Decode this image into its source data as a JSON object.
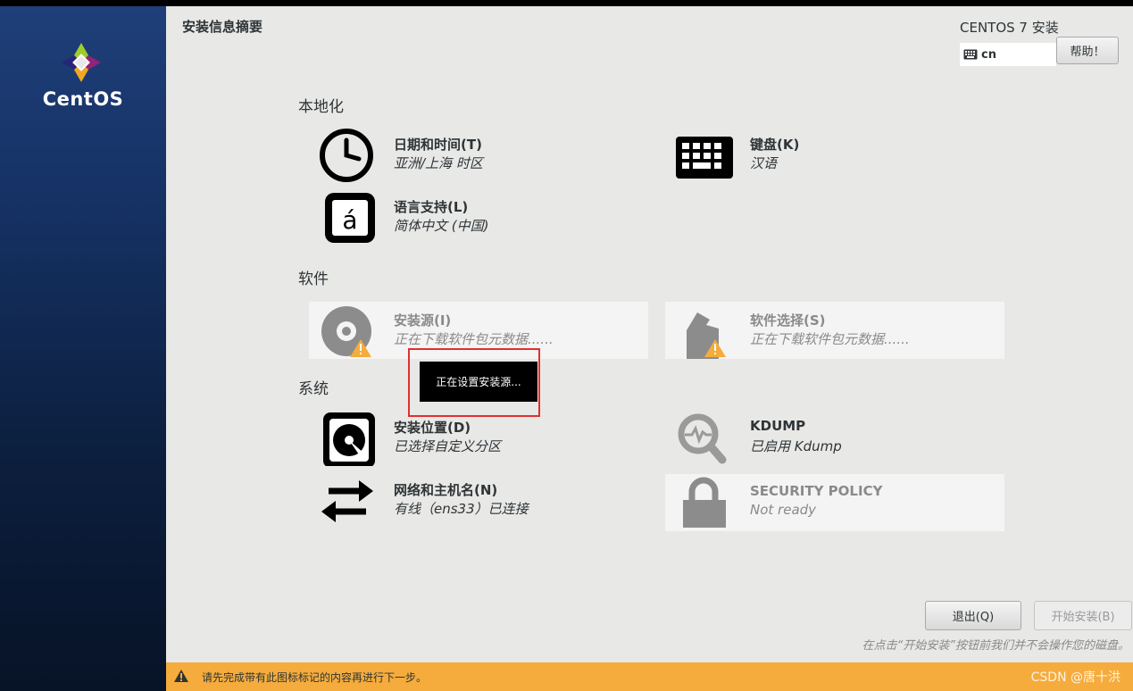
{
  "sidebar": {
    "logo_text": "CentOS"
  },
  "header": {
    "title": "安装信息摘要",
    "product": "CENTOS 7 安装",
    "keyboard_layout": "cn",
    "help_label": "帮助！"
  },
  "sections": {
    "localization": "本地化",
    "software": "软件",
    "system": "系统"
  },
  "spokes": {
    "datetime": {
      "title": "日期和时间(T)",
      "status": "亚洲/上海 时区",
      "icon": "clock-icon"
    },
    "keyboard": {
      "title": "键盘(K)",
      "status": "汉语",
      "icon": "keyboard-icon"
    },
    "language": {
      "title": "语言支持(L)",
      "status": "简体中文 (中国)",
      "icon": "language-icon"
    },
    "source": {
      "title": "安装源(I)",
      "status": "正在下载软件包元数据......",
      "icon": "disc-icon"
    },
    "software": {
      "title": "软件选择(S)",
      "status": "正在下载软件包元数据......",
      "icon": "package-icon"
    },
    "destination": {
      "title": "安装位置(D)",
      "status": "已选择自定义分区",
      "icon": "harddisk-icon"
    },
    "kdump": {
      "title": "KDUMP",
      "status": "已启用 Kdump",
      "icon": "magnifier-icon"
    },
    "network": {
      "title": "网络和主机名(N)",
      "status": "有线（ens33）已连接",
      "icon": "network-arrows-icon"
    },
    "security": {
      "title": "SECURITY POLICY",
      "status": "Not ready",
      "icon": "lock-icon"
    }
  },
  "tooltip": "正在设置安装源...",
  "buttons": {
    "quit": "退出(Q)",
    "begin": "开始安装(B)"
  },
  "note": "在点击“开始安装”按钮前我们并不会操作您的磁盘。",
  "warning_bar": {
    "message": "请先完成带有此图标标记的内容再进行下一步。",
    "watermark": "CSDN @唐十洪"
  },
  "colors": {
    "warning": "#f5ac3c",
    "sidebar": "#153163",
    "background": "#e8e8e7"
  }
}
